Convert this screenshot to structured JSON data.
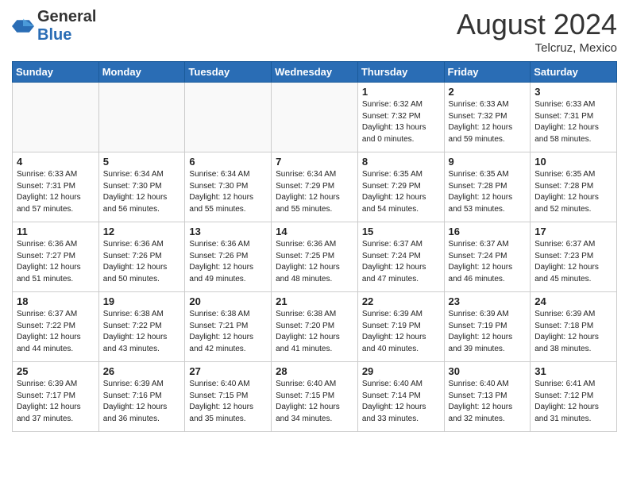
{
  "logo": {
    "general": "General",
    "blue": "Blue"
  },
  "title": {
    "month_year": "August 2024",
    "location": "Telcruz, Mexico"
  },
  "weekdays": [
    "Sunday",
    "Monday",
    "Tuesday",
    "Wednesday",
    "Thursday",
    "Friday",
    "Saturday"
  ],
  "weeks": [
    [
      {
        "day": "",
        "info": ""
      },
      {
        "day": "",
        "info": ""
      },
      {
        "day": "",
        "info": ""
      },
      {
        "day": "",
        "info": ""
      },
      {
        "day": "1",
        "sunrise": "Sunrise: 6:32 AM",
        "sunset": "Sunset: 7:32 PM",
        "daylight": "Daylight: 13 hours and 0 minutes."
      },
      {
        "day": "2",
        "sunrise": "Sunrise: 6:33 AM",
        "sunset": "Sunset: 7:32 PM",
        "daylight": "Daylight: 12 hours and 59 minutes."
      },
      {
        "day": "3",
        "sunrise": "Sunrise: 6:33 AM",
        "sunset": "Sunset: 7:31 PM",
        "daylight": "Daylight: 12 hours and 58 minutes."
      }
    ],
    [
      {
        "day": "4",
        "sunrise": "Sunrise: 6:33 AM",
        "sunset": "Sunset: 7:31 PM",
        "daylight": "Daylight: 12 hours and 57 minutes."
      },
      {
        "day": "5",
        "sunrise": "Sunrise: 6:34 AM",
        "sunset": "Sunset: 7:30 PM",
        "daylight": "Daylight: 12 hours and 56 minutes."
      },
      {
        "day": "6",
        "sunrise": "Sunrise: 6:34 AM",
        "sunset": "Sunset: 7:30 PM",
        "daylight": "Daylight: 12 hours and 55 minutes."
      },
      {
        "day": "7",
        "sunrise": "Sunrise: 6:34 AM",
        "sunset": "Sunset: 7:29 PM",
        "daylight": "Daylight: 12 hours and 55 minutes."
      },
      {
        "day": "8",
        "sunrise": "Sunrise: 6:35 AM",
        "sunset": "Sunset: 7:29 PM",
        "daylight": "Daylight: 12 hours and 54 minutes."
      },
      {
        "day": "9",
        "sunrise": "Sunrise: 6:35 AM",
        "sunset": "Sunset: 7:28 PM",
        "daylight": "Daylight: 12 hours and 53 minutes."
      },
      {
        "day": "10",
        "sunrise": "Sunrise: 6:35 AM",
        "sunset": "Sunset: 7:28 PM",
        "daylight": "Daylight: 12 hours and 52 minutes."
      }
    ],
    [
      {
        "day": "11",
        "sunrise": "Sunrise: 6:36 AM",
        "sunset": "Sunset: 7:27 PM",
        "daylight": "Daylight: 12 hours and 51 minutes."
      },
      {
        "day": "12",
        "sunrise": "Sunrise: 6:36 AM",
        "sunset": "Sunset: 7:26 PM",
        "daylight": "Daylight: 12 hours and 50 minutes."
      },
      {
        "day": "13",
        "sunrise": "Sunrise: 6:36 AM",
        "sunset": "Sunset: 7:26 PM",
        "daylight": "Daylight: 12 hours and 49 minutes."
      },
      {
        "day": "14",
        "sunrise": "Sunrise: 6:36 AM",
        "sunset": "Sunset: 7:25 PM",
        "daylight": "Daylight: 12 hours and 48 minutes."
      },
      {
        "day": "15",
        "sunrise": "Sunrise: 6:37 AM",
        "sunset": "Sunset: 7:24 PM",
        "daylight": "Daylight: 12 hours and 47 minutes."
      },
      {
        "day": "16",
        "sunrise": "Sunrise: 6:37 AM",
        "sunset": "Sunset: 7:24 PM",
        "daylight": "Daylight: 12 hours and 46 minutes."
      },
      {
        "day": "17",
        "sunrise": "Sunrise: 6:37 AM",
        "sunset": "Sunset: 7:23 PM",
        "daylight": "Daylight: 12 hours and 45 minutes."
      }
    ],
    [
      {
        "day": "18",
        "sunrise": "Sunrise: 6:37 AM",
        "sunset": "Sunset: 7:22 PM",
        "daylight": "Daylight: 12 hours and 44 minutes."
      },
      {
        "day": "19",
        "sunrise": "Sunrise: 6:38 AM",
        "sunset": "Sunset: 7:22 PM",
        "daylight": "Daylight: 12 hours and 43 minutes."
      },
      {
        "day": "20",
        "sunrise": "Sunrise: 6:38 AM",
        "sunset": "Sunset: 7:21 PM",
        "daylight": "Daylight: 12 hours and 42 minutes."
      },
      {
        "day": "21",
        "sunrise": "Sunrise: 6:38 AM",
        "sunset": "Sunset: 7:20 PM",
        "daylight": "Daylight: 12 hours and 41 minutes."
      },
      {
        "day": "22",
        "sunrise": "Sunrise: 6:39 AM",
        "sunset": "Sunset: 7:19 PM",
        "daylight": "Daylight: 12 hours and 40 minutes."
      },
      {
        "day": "23",
        "sunrise": "Sunrise: 6:39 AM",
        "sunset": "Sunset: 7:19 PM",
        "daylight": "Daylight: 12 hours and 39 minutes."
      },
      {
        "day": "24",
        "sunrise": "Sunrise: 6:39 AM",
        "sunset": "Sunset: 7:18 PM",
        "daylight": "Daylight: 12 hours and 38 minutes."
      }
    ],
    [
      {
        "day": "25",
        "sunrise": "Sunrise: 6:39 AM",
        "sunset": "Sunset: 7:17 PM",
        "daylight": "Daylight: 12 hours and 37 minutes."
      },
      {
        "day": "26",
        "sunrise": "Sunrise: 6:39 AM",
        "sunset": "Sunset: 7:16 PM",
        "daylight": "Daylight: 12 hours and 36 minutes."
      },
      {
        "day": "27",
        "sunrise": "Sunrise: 6:40 AM",
        "sunset": "Sunset: 7:15 PM",
        "daylight": "Daylight: 12 hours and 35 minutes."
      },
      {
        "day": "28",
        "sunrise": "Sunrise: 6:40 AM",
        "sunset": "Sunset: 7:15 PM",
        "daylight": "Daylight: 12 hours and 34 minutes."
      },
      {
        "day": "29",
        "sunrise": "Sunrise: 6:40 AM",
        "sunset": "Sunset: 7:14 PM",
        "daylight": "Daylight: 12 hours and 33 minutes."
      },
      {
        "day": "30",
        "sunrise": "Sunrise: 6:40 AM",
        "sunset": "Sunset: 7:13 PM",
        "daylight": "Daylight: 12 hours and 32 minutes."
      },
      {
        "day": "31",
        "sunrise": "Sunrise: 6:41 AM",
        "sunset": "Sunset: 7:12 PM",
        "daylight": "Daylight: 12 hours and 31 minutes."
      }
    ]
  ]
}
